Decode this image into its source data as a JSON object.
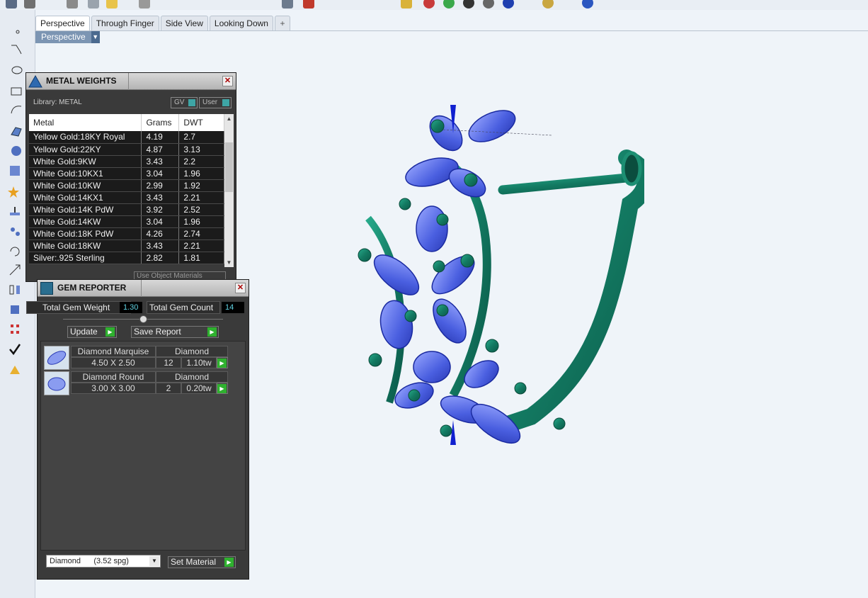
{
  "tabs": {
    "items": [
      "Perspective",
      "Through Finger",
      "Side View",
      "Looking Down"
    ],
    "add": "+"
  },
  "viewport": {
    "label": "Perspective",
    "dropdown": "▼"
  },
  "metal_weights": {
    "title": "METAL WEIGHTS",
    "library": "Library: METAL",
    "toggle_gv": "GV",
    "toggle_user": "User",
    "columns": [
      "Metal",
      "Grams",
      "DWT"
    ],
    "rows": [
      [
        "Yellow Gold:18KY Royal",
        "4.19",
        "2.7"
      ],
      [
        "Yellow Gold:22KY",
        "4.87",
        "3.13"
      ],
      [
        "White Gold:9KW",
        "3.43",
        "2.2"
      ],
      [
        "White Gold:10KX1",
        "3.04",
        "1.96"
      ],
      [
        "White Gold:10KW",
        "2.99",
        "1.92"
      ],
      [
        "White Gold:14KX1",
        "3.43",
        "2.21"
      ],
      [
        "White Gold:14K PdW",
        "3.92",
        "2.52"
      ],
      [
        "White Gold:14KW",
        "3.04",
        "1.96"
      ],
      [
        "White Gold:18K PdW",
        "4.26",
        "2.74"
      ],
      [
        "White Gold:18KW",
        "3.43",
        "2.21"
      ],
      [
        "Silver:.925 Sterling",
        "2.82",
        "1.81"
      ]
    ],
    "use_object_materials": "Use Object Materials"
  },
  "gem_reporter": {
    "title": "GEM REPORTER",
    "total_weight_label": "Total Gem Weight",
    "total_weight_value": "1.30",
    "total_count_label": "Total Gem Count",
    "total_count_value": "14",
    "update_label": "Update",
    "save_report_label": "Save Report",
    "gems": [
      {
        "name": "Diamond Marquise",
        "material": "Diamond",
        "size": "4.50 X 2.50",
        "count": "12",
        "weight": "1.10tw"
      },
      {
        "name": "Diamond Round",
        "material": "Diamond",
        "size": "3.00 X 3.00",
        "count": "2",
        "weight": "0.20tw"
      }
    ],
    "material_select": "Diamond      (3.52 spg)",
    "set_material_label": "Set Material"
  },
  "colors": {
    "metal": "#1c8a70",
    "gem": "#4a5fe0",
    "panel_bg": "#3a3a3a"
  }
}
